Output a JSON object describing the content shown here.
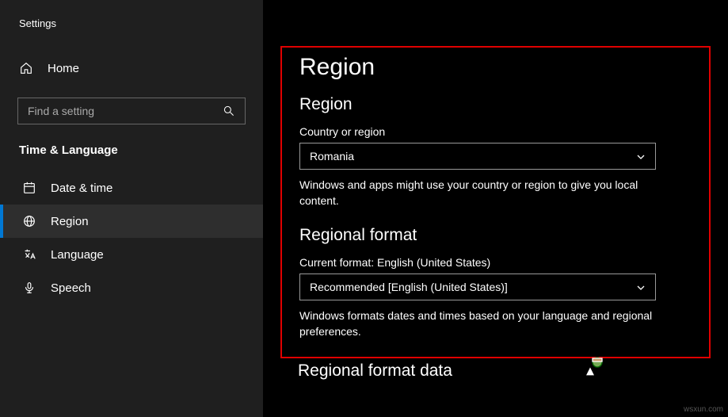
{
  "app_title": "Settings",
  "home_label": "Home",
  "search": {
    "placeholder": "Find a setting"
  },
  "section_title": "Time & Language",
  "nav": {
    "items": [
      {
        "label": "Date & time"
      },
      {
        "label": "Region"
      },
      {
        "label": "Language"
      },
      {
        "label": "Speech"
      }
    ]
  },
  "page": {
    "title": "Region",
    "region": {
      "heading": "Region",
      "field_label": "Country or region",
      "value": "Romania",
      "help": "Windows and apps might use your country or region to give you local content."
    },
    "regional_format": {
      "heading": "Regional format",
      "current_label": "Current format: English (United States)",
      "value": "Recommended [English (United States)]",
      "help": "Windows formats dates and times based on your language and regional preferences."
    },
    "format_data_heading": "Regional format data"
  },
  "watermark": "wsxun.com"
}
